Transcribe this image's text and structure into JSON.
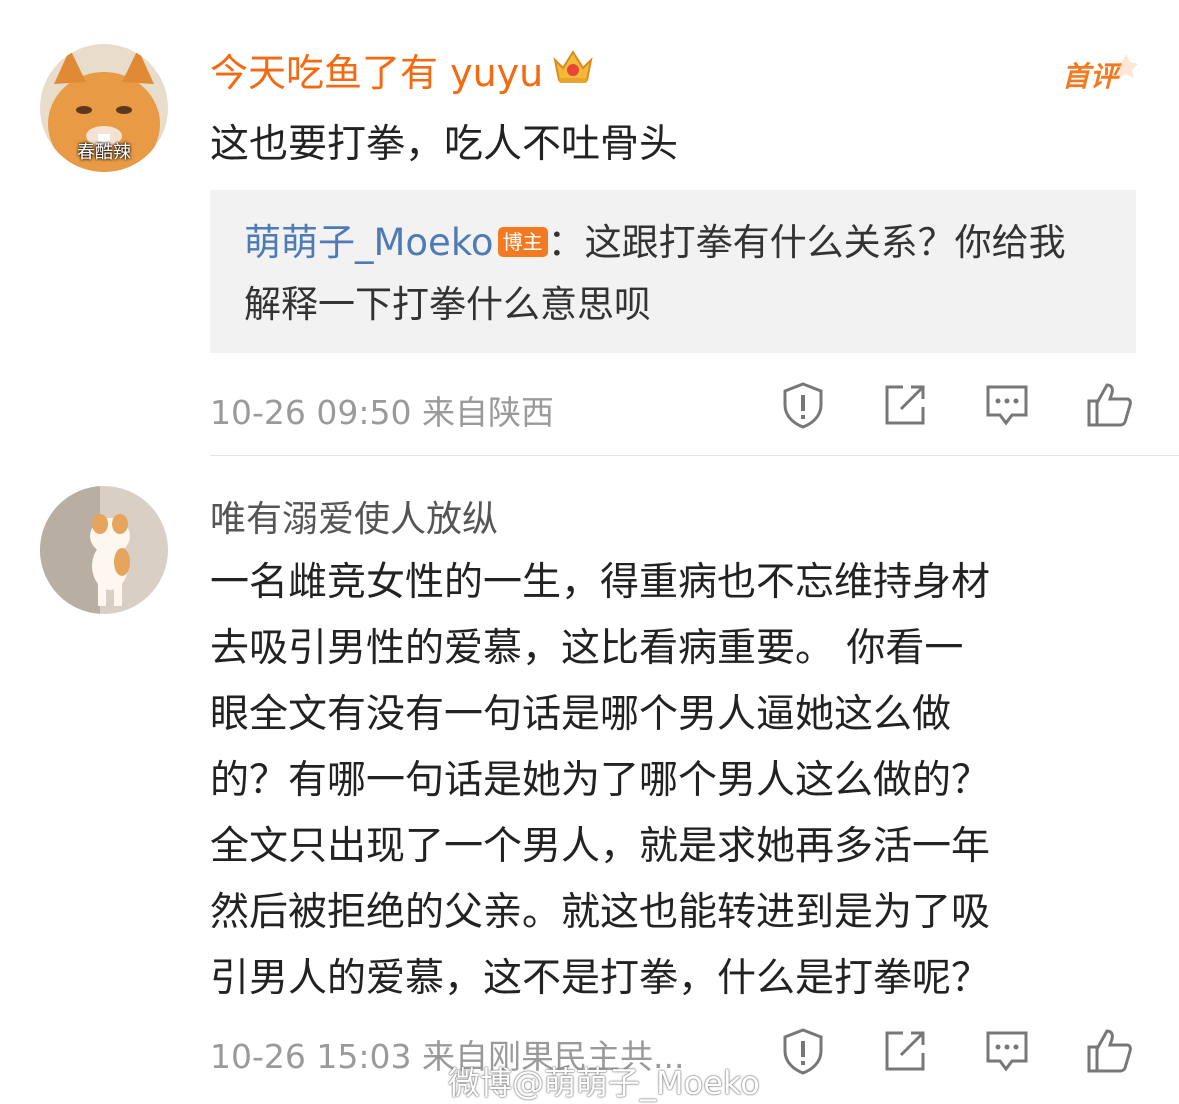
{
  "comment1": {
    "avatar_caption": "春酷辣",
    "username": "今天吃鱼了有 yuyu",
    "badge": "首评",
    "text": "这也要打拳，吃人不吐骨头",
    "reply": {
      "name": "萌萌子_Moeko",
      "role_badge": "博主",
      "text": "：这跟打拳有什么关系？你给我解释一下打拳什么意思呗"
    },
    "meta": "10-26 09:50  来自陕西"
  },
  "comment2": {
    "username": "唯有溺爱使人放纵",
    "lines": [
      "一名雌竞女性的一生，得重病也不忘维持身材",
      "去吸引男性的爱慕，这比看病重要。 你看一",
      "眼全文有没有一句话是哪个男人逼她这么做",
      "的？有哪一句话是她为了哪个男人这么做的？",
      "全文只出现了一个男人，就是求她再多活一年",
      "然后被拒绝的父亲。就这也能转进到是为了吸",
      "引男人的爱慕，这不是打拳，什么是打拳呢？"
    ],
    "meta": "10-26 15:03  来自刚果民主共..."
  },
  "watermark": "微博@萌萌子_Moeko",
  "icons": [
    "report-icon",
    "share-icon",
    "comment-icon",
    "like-icon"
  ],
  "colors": {
    "username": "#f36a13",
    "reply_name": "#4f7bb5",
    "badge": "#f47a22",
    "meta": "#9a9a9a"
  }
}
